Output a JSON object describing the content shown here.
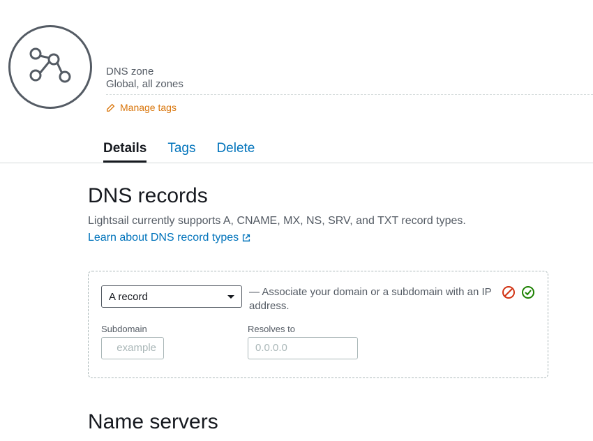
{
  "header": {
    "resource_type": "DNS zone",
    "resource_location": "Global, all zones",
    "manage_tags_label": "Manage tags"
  },
  "tabs": {
    "details": "Details",
    "tags": "Tags",
    "delete": "Delete"
  },
  "dns_records": {
    "heading": "DNS records",
    "support_text": "Lightsail currently supports A, CNAME, MX, NS, SRV, and TXT record types.",
    "learn_link": "Learn about DNS record types",
    "record_type_selected": "A record",
    "assoc_prefix": "— ",
    "assoc_text": "Associate your domain or a subdomain with an IP address.",
    "subdomain_label": "Subdomain",
    "subdomain_placeholder": "example",
    "resolves_label": "Resolves to",
    "resolves_placeholder": "0.0.0.0"
  },
  "name_servers": {
    "heading": "Name servers"
  }
}
